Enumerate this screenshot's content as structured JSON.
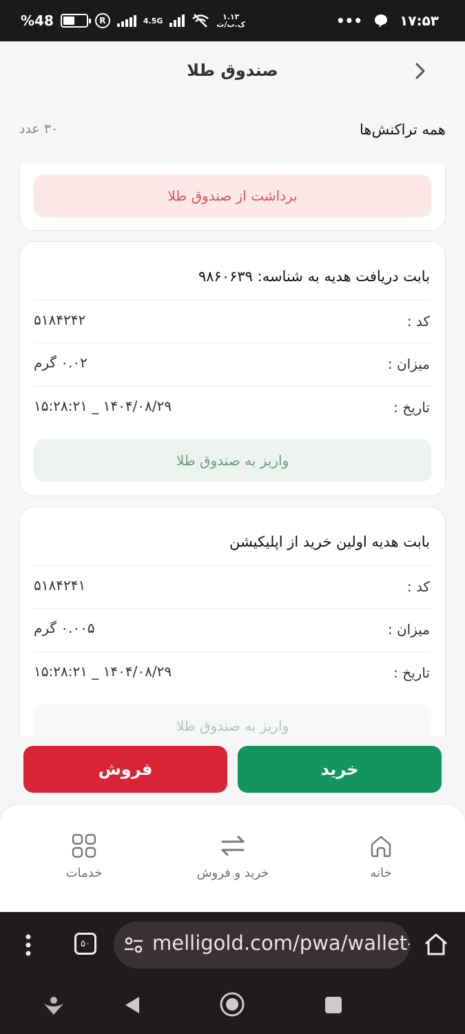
{
  "status_bar": {
    "battery": "%48",
    "network": "4.5G",
    "speed_value": "۱.۱۳",
    "speed_unit": "ک.ب/ث",
    "dots": "•••",
    "time": "۱۷:۵۳"
  },
  "header": {
    "title": "صندوق طلا"
  },
  "transactions": {
    "title": "همه تراکنش‌ها",
    "count": "۳۰ عدد"
  },
  "cards": [
    {
      "button": "برداشت از صندوق طلا"
    },
    {
      "title": "بابت دریافت هدیه به شناسه: ۹۸۶۰۶۳۹",
      "code_label": "کد :",
      "code": "۵۱۸۴۲۴۲",
      "amount_label": "میزان :",
      "amount": "۰.۰۲ گرم",
      "date_label": "تاریخ :",
      "date": "۱۴۰۴/۰۸/۲۹ _ ۱۵:۲۸:۲۱",
      "button": "واریز به صندوق طلا"
    },
    {
      "title": "بابت هدیه اولین خرید از اپلیکیشن",
      "code_label": "کد :",
      "code": "۵۱۸۴۲۴۱",
      "amount_label": "میزان :",
      "amount": "۰.۰۰۵ گرم",
      "date_label": "تاریخ :",
      "date": "۱۴۰۴/۰۸/۲۹ _ ۱۵:۲۸:۲۱",
      "button": "واریز به صندوق طلا"
    }
  ],
  "actions": {
    "buy": "خرید",
    "sell": "فروش"
  },
  "bottom_nav": {
    "home": "خانه",
    "trade": "خرید و فروش",
    "services": "خدمات"
  },
  "browser": {
    "url": "melligold.com/pwa/wallet-",
    "tabs": "۵۰"
  },
  "colors": {
    "buy": "#12955f",
    "sell": "#d92535",
    "deposit_bg": "#eef3f0",
    "withdraw_bg": "#fde8e8"
  }
}
